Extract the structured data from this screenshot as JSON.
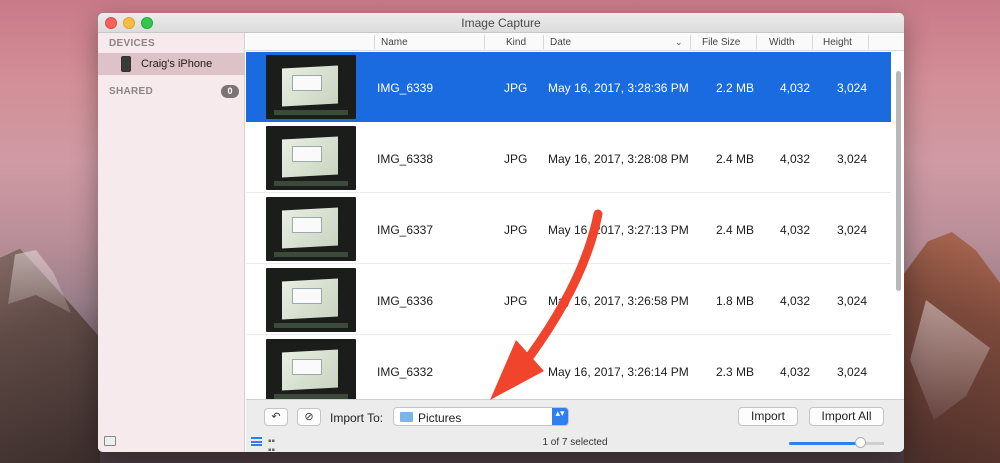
{
  "window": {
    "title": "Image Capture"
  },
  "sidebar": {
    "devices_heading": "DEVICES",
    "device_name": "Craig's iPhone",
    "shared_heading": "SHARED",
    "shared_count": "0"
  },
  "columns": {
    "name": "Name",
    "kind": "Kind",
    "date": "Date",
    "file_size": "File Size",
    "width": "Width",
    "height": "Height"
  },
  "rows": [
    {
      "name": "IMG_6339",
      "kind": "JPG",
      "date": "May 16, 2017, 3:28:36 PM",
      "size": "2.2 MB",
      "width": "4,032",
      "height": "3,024",
      "selected": true
    },
    {
      "name": "IMG_6338",
      "kind": "JPG",
      "date": "May 16, 2017, 3:28:08 PM",
      "size": "2.4 MB",
      "width": "4,032",
      "height": "3,024",
      "selected": false
    },
    {
      "name": "IMG_6337",
      "kind": "JPG",
      "date": "May 16, 2017, 3:27:13 PM",
      "size": "2.4 MB",
      "width": "4,032",
      "height": "3,024",
      "selected": false
    },
    {
      "name": "IMG_6336",
      "kind": "JPG",
      "date": "May 16, 2017, 3:26:58 PM",
      "size": "1.8 MB",
      "width": "4,032",
      "height": "3,024",
      "selected": false
    },
    {
      "name": "IMG_6332",
      "kind": "JPG",
      "date": "May 16, 2017, 3:26:14 PM",
      "size": "2.3 MB",
      "width": "4,032",
      "height": "3,024",
      "selected": false
    }
  ],
  "toolbar": {
    "rotate_glyph": "↶",
    "delete_glyph": "⊘",
    "import_to_label": "Import To:",
    "import_destination": "Pictures",
    "select_arrows": "▴▾",
    "import_label": "Import",
    "import_all_label": "Import All",
    "status": "1 of 7 selected"
  },
  "thumbnail_size_fraction": 0.7,
  "icons": [
    "phone-icon",
    "rotate-icon",
    "delete-icon",
    "folder-icon",
    "list-view-icon",
    "grid-view-icon",
    "sidebar-toggle-icon"
  ],
  "colors": {
    "selection": "#1a6be0",
    "accent": "#2f7ff0",
    "annotation_arrow": "#f0442c"
  }
}
